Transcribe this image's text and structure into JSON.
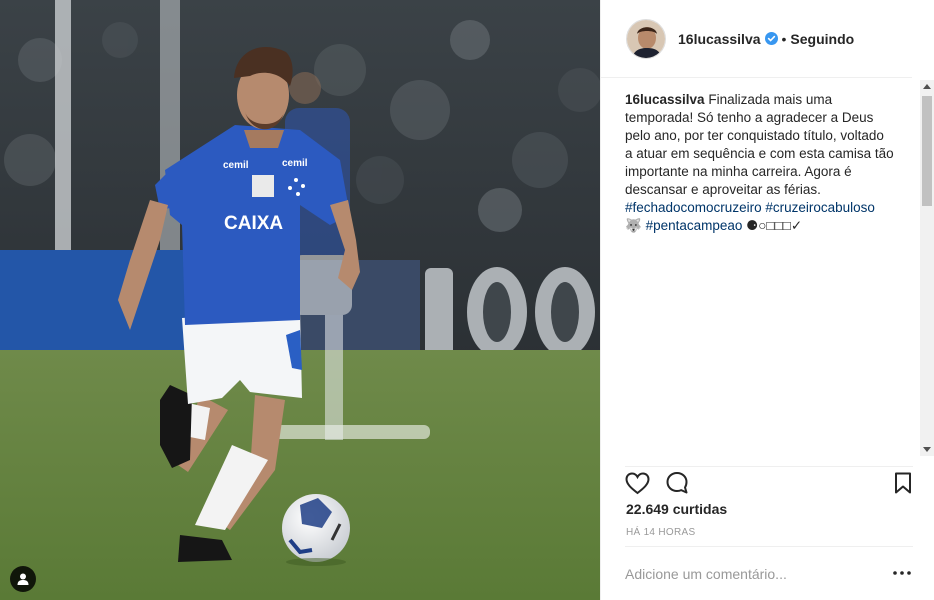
{
  "post": {
    "username": "16lucassilva",
    "follow_state": "Seguindo",
    "separator": "•",
    "caption": {
      "text": "Finalizada mais uma temporada! Só tenho a agradecer a Deus pelo ano, por ter conquistado título, voltado a atuar em sequência e com esta camisa tão importante na minha carreira. Agora é descansar e aproveitar as férias.",
      "hashtag_1": "#fechadocomocruzeiro",
      "hashtag_2": "#cruzeirocabuloso",
      "emoji_1": "🐺",
      "hashtag_3": "#pentacampeao",
      "trailing_emojis": "⚈○□□□✓"
    },
    "likes": "22.649 curtidas",
    "time": "HÁ 14 HORAS"
  },
  "comment": {
    "placeholder": "Adicione um comentário..."
  },
  "photo": {
    "jersey_sponsor": "CAIXA",
    "jersey_brand": "cemil",
    "stadium_banner": "100"
  },
  "colors": {
    "accent": "#003569",
    "verified": "#3897f0",
    "text": "#262626",
    "muted": "#999999"
  },
  "icons": [
    "tag-icon",
    "verified-icon",
    "heart-icon",
    "comment-icon",
    "bookmark-icon",
    "more-options-icon"
  ]
}
